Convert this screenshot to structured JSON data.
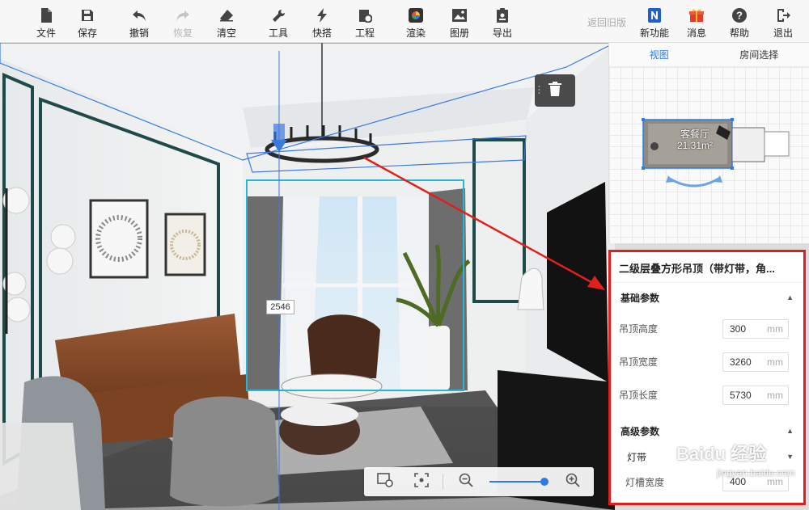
{
  "toolbar": {
    "file": "文件",
    "save": "保存",
    "undo": "撤销",
    "redo": "恢复",
    "clear": "清空",
    "tools": "工具",
    "quick_build": "快搭",
    "project": "工程",
    "render": "渲染",
    "album": "图册",
    "export": "导出",
    "back_old": "返回旧版",
    "new_feature": "新功能",
    "message": "消息",
    "help": "帮助",
    "exit": "退出"
  },
  "panel": {
    "tab_view": "视图",
    "tab_room": "房间选择",
    "room_name": "客餐厅",
    "room_area": "21.31m²"
  },
  "props": {
    "title": "二级层叠方形吊顶（带灯带，角...",
    "basic_section": "基础参数",
    "fields": [
      {
        "label": "吊顶高度",
        "value": "300",
        "unit": "mm"
      },
      {
        "label": "吊顶宽度",
        "value": "3260",
        "unit": "mm"
      },
      {
        "label": "吊顶长度",
        "value": "5730",
        "unit": "mm"
      }
    ],
    "advanced_section": "高级参数",
    "sub_label": "灯带",
    "slot_label": "灯槽宽度",
    "slot_value": "400",
    "slot_unit": "mm"
  },
  "scene": {
    "dimension_label": "2546"
  },
  "zoom": {
    "level": 0.85
  },
  "watermark": {
    "main": "Baidu 经验",
    "sub": "jingyan.baidu.com"
  },
  "colors": {
    "accent": "#2d7be5",
    "highlight_border": "#e21d1d",
    "selection": "#27b6d8"
  }
}
